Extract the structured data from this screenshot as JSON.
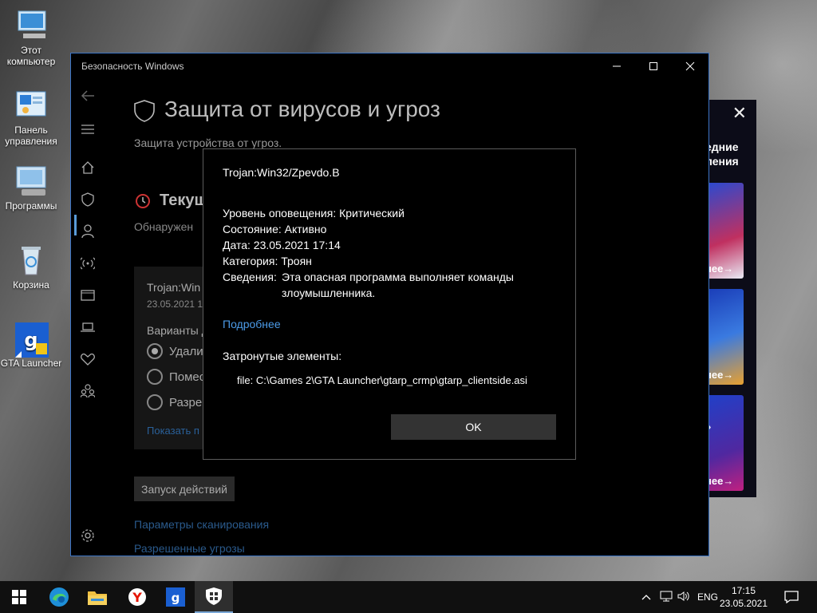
{
  "desktop": {
    "icons": [
      {
        "label": "Этот компьютер",
        "name": "this-pc"
      },
      {
        "label": "Панель управления",
        "name": "control-panel"
      },
      {
        "label": "Программы",
        "name": "programs"
      },
      {
        "label": "Корзина",
        "name": "recycle-bin"
      },
      {
        "label": "GTA Launcher",
        "name": "gta-launcher"
      }
    ]
  },
  "ad": {
    "close": "✕",
    "heading_line1": "едние",
    "heading_line2": "ления",
    "more1": "нее→",
    "more2": "нее→",
    "mid": "»",
    "more3": "нее→"
  },
  "window": {
    "title": "Безопасность Windows",
    "page_title": "Защита от вирусов и угроз",
    "page_subtitle": "Защита устройства от угроз.",
    "section_title": "Текущ",
    "section_subtitle": "Обнаружен",
    "threat": {
      "name": "Trojan:Win",
      "date": "23.05.2021 1",
      "options_title": "Варианты д",
      "options": [
        "Удалит",
        "Помес",
        "Разрец"
      ],
      "show_link": "Показать п"
    },
    "action_button": "Запуск действий",
    "link_scan_params": "Параметры сканирования",
    "link_allowed": "Разрешенные угрозы"
  },
  "dialog": {
    "title": "Trojan:Win32/Zpevdo.B",
    "alert_level": "Уровень оповещения: Критический",
    "status": "Состояние: Активно",
    "date": "Дата: 23.05.2021 17:14",
    "category": "Категория:  Троян",
    "details_label": "Сведения:",
    "details_line1": "Эта опасная программа выполняет команды",
    "details_line2": "злоумышленника.",
    "more_link": "Подробнее",
    "affected_label": "Затронутые элементы:",
    "affected_file": "file: C:\\Games 2\\GTA Launcher\\gtarp_crmp\\gtarp_clientside.asi",
    "ok_button": "OK"
  },
  "taskbar": {
    "language": "ENG",
    "time": "17:15",
    "date": "23.05.2021"
  }
}
